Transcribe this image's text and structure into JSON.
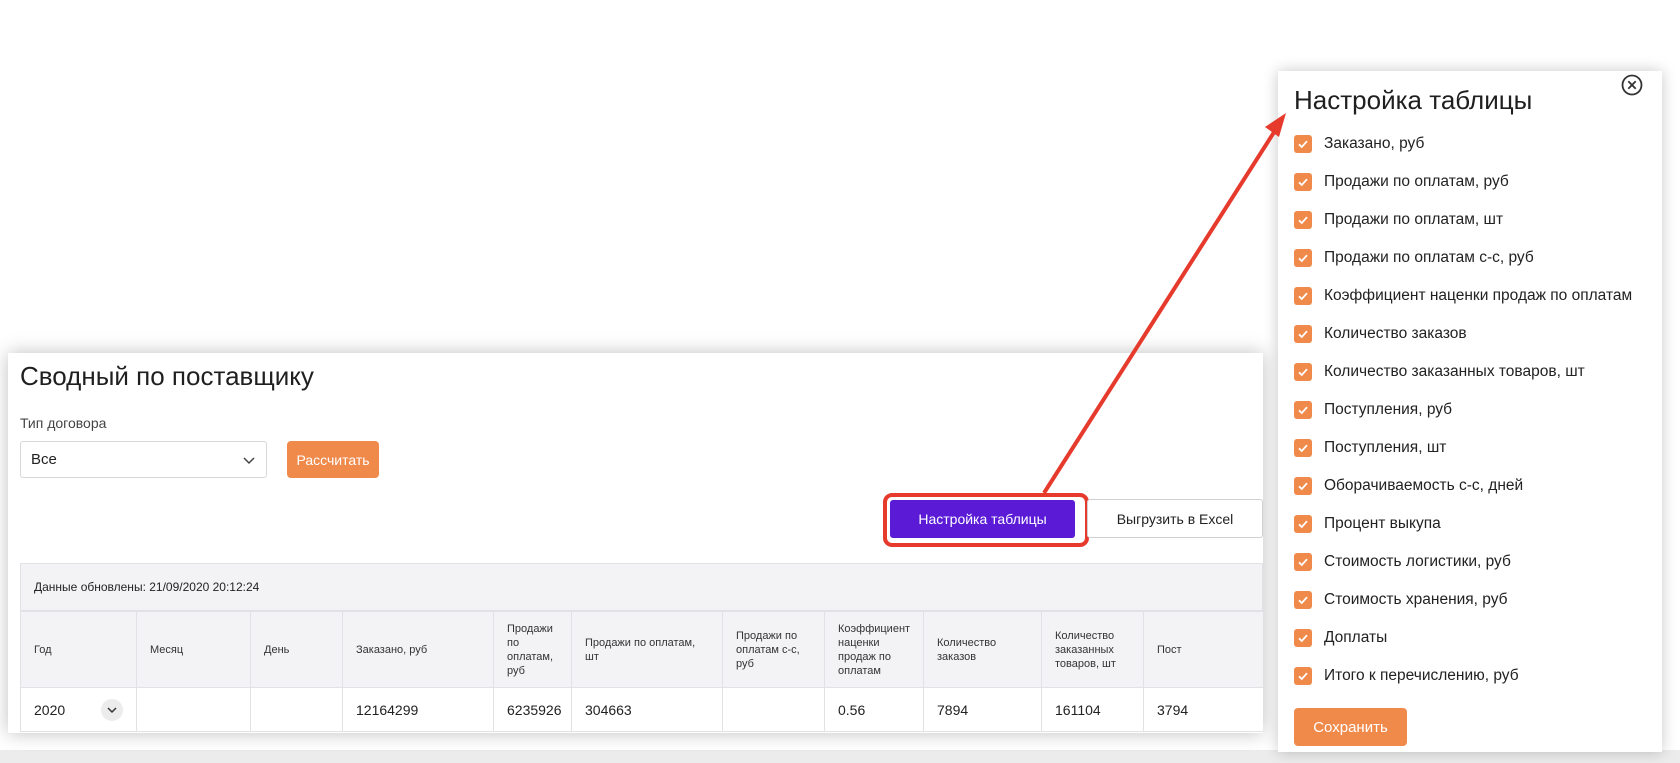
{
  "main": {
    "title": "Сводный по поставщику",
    "contract_label": "Тип договора",
    "contract_value": "Все",
    "calc_button": "Рассчитать",
    "settings_button": "Настройка таблицы",
    "excel_button": "Выгрузить в Excel",
    "updated_text": "Данные обновлены: 21/09/2020 20:12:24"
  },
  "table": {
    "headers": [
      "Год",
      "Месяц",
      "День",
      "Заказано, руб",
      "Продажи по оплатам, руб",
      "Продажи по оплатам, шт",
      "Продажи по оплатам с-с, руб",
      "Коэффициент наценки продаж по оплатам",
      "Количество заказов",
      "Количество заказанных товаров, шт",
      "Пост"
    ],
    "rows": [
      [
        "2020",
        "",
        "",
        "12164299",
        "6235926",
        "304663",
        "",
        "0.56",
        "7894",
        "161104",
        "3794"
      ]
    ]
  },
  "settings_modal": {
    "title": "Настройка таблицы",
    "options": [
      {
        "label": "Заказано, руб",
        "checked": true
      },
      {
        "label": "Продажи по оплатам, руб",
        "checked": true
      },
      {
        "label": "Продажи по оплатам, шт",
        "checked": true
      },
      {
        "label": "Продажи по оплатам с-с, руб",
        "checked": true
      },
      {
        "label": "Коэффициент наценки продаж по оплатам",
        "checked": true
      },
      {
        "label": "Количество заказов",
        "checked": true
      },
      {
        "label": "Количество заказанных товаров, шт",
        "checked": true
      },
      {
        "label": "Поступления, руб",
        "checked": true
      },
      {
        "label": "Поступления, шт",
        "checked": true
      },
      {
        "label": "Оборачиваемость с-с, дней",
        "checked": true
      },
      {
        "label": "Процент выкупа",
        "checked": true
      },
      {
        "label": "Стоимость логистики, руб",
        "checked": true
      },
      {
        "label": "Стоимость хранения, руб",
        "checked": true
      },
      {
        "label": "Доплаты",
        "checked": true
      },
      {
        "label": "Итого к перечислению, руб",
        "checked": true
      }
    ],
    "save_button": "Сохранить"
  },
  "colors": {
    "accent_orange": "#f08a4b",
    "primary_purple": "#5a1ad6",
    "annotation_red": "#e53a2c"
  },
  "icons": [
    "chevron-down-icon",
    "close-circle-icon",
    "checkmark-icon"
  ]
}
